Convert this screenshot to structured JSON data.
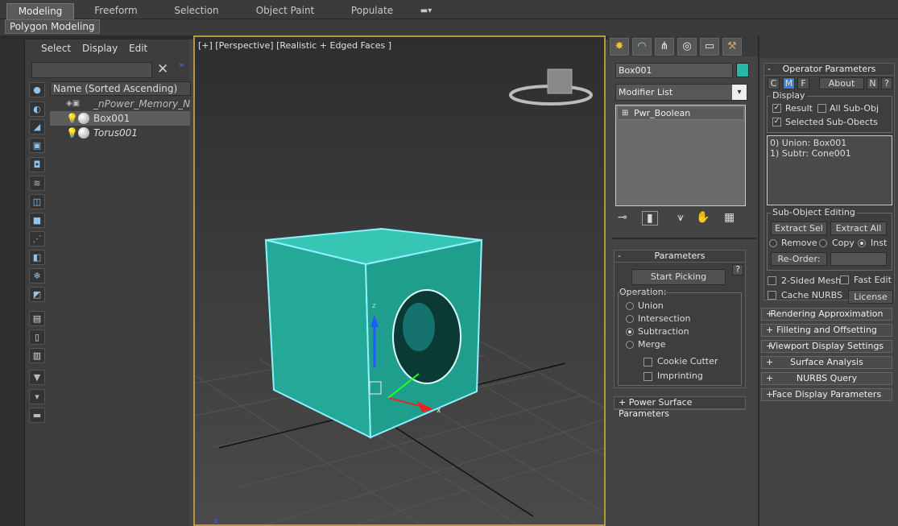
{
  "ribbon": {
    "tabs": [
      "Modeling",
      "Freeform",
      "Selection",
      "Object Paint",
      "Populate"
    ],
    "sub_tab": "Polygon Modeling"
  },
  "scene": {
    "menus": [
      "Select",
      "Display",
      "Edit"
    ],
    "column_header": "Name (Sorted Ascending)",
    "rows": [
      "_nPower_Memory_N",
      "Box001",
      "Torus001"
    ]
  },
  "viewport": {
    "label": "[+] [Perspective] [Realistic + Edged Faces ]",
    "axis_labels": [
      "z",
      "x",
      "z"
    ]
  },
  "command_panel": {
    "object_name": "Box001",
    "object_color": "#28b6a5",
    "modifier_list": "Modifier List",
    "stack_item": "Pwr_Boolean",
    "parameters": {
      "title": "Parameters",
      "help": "?",
      "start_picking": "Start Picking",
      "operation_label": "Operation:",
      "operations": [
        "Union",
        "Intersection",
        "Subtraction",
        "Merge"
      ],
      "selected_operation": "Subtraction",
      "cookie_cutter": "Cookie Cutter",
      "imprinting": "Imprinting"
    },
    "power_surface": "Power Surface Parameters"
  },
  "operator": {
    "title": "Operator Parameters",
    "c": "C",
    "m": "M",
    "f": "F",
    "about": "About",
    "n": "N",
    "help": "?",
    "display": {
      "label": "Display",
      "result": "Result",
      "all_sub": "All Sub-Obj",
      "selected_sub": "Selected Sub-Obects"
    },
    "list": [
      "0) Union: Box001",
      "1) Subtr: Cone001"
    ],
    "subobj": {
      "label": "Sub-Object Editing",
      "extract_sel": "Extract Sel",
      "extract_all": "Extract All",
      "remove": "Remove",
      "copy": "Copy",
      "inst": "Inst",
      "reorder": "Re-Order:"
    },
    "two_sided": "2-Sided Mesh",
    "fast_edit": "Fast Edit",
    "cache_nurbs": "Cache NURBS",
    "license": "License",
    "rollouts": [
      "Rendering Approximation",
      "Filleting and Offsetting",
      "Viewport Display Settings",
      "Surface Analysis",
      "NURBS Query",
      "Face Display Parameters"
    ]
  }
}
